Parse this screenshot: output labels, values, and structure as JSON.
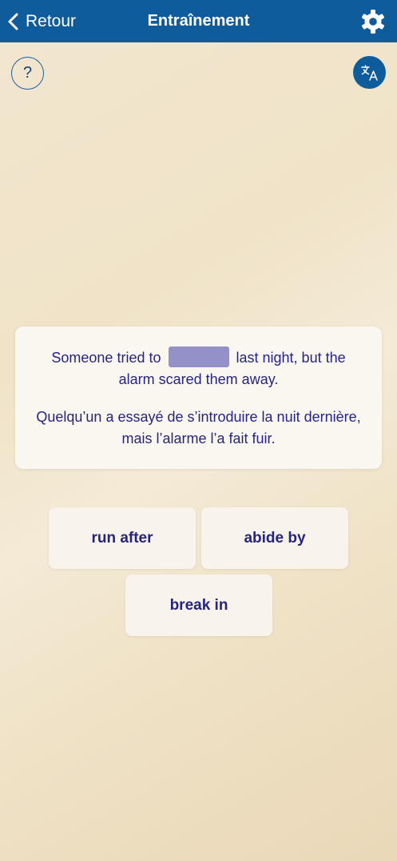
{
  "navbar": {
    "back_label": "Retour",
    "title": "Entraînement"
  },
  "toolbar": {
    "help_symbol": "?"
  },
  "exercise": {
    "sentence_before": "Someone tried to",
    "sentence_after": "last night, but the alarm scared them away.",
    "translation": "Quelqu’un a essayé de s’introduire la nuit dernière, mais l’alarme l’a fait fuir."
  },
  "options": [
    "run after",
    "abide by",
    "break in"
  ],
  "colors": {
    "navbar": "#0f5c9d",
    "text": "#27247f",
    "blank": "#9391c8"
  },
  "icons": {
    "back": "chevron-left-icon",
    "settings": "gear-icon",
    "help": "question-circle-icon",
    "translate": "translate-icon"
  }
}
